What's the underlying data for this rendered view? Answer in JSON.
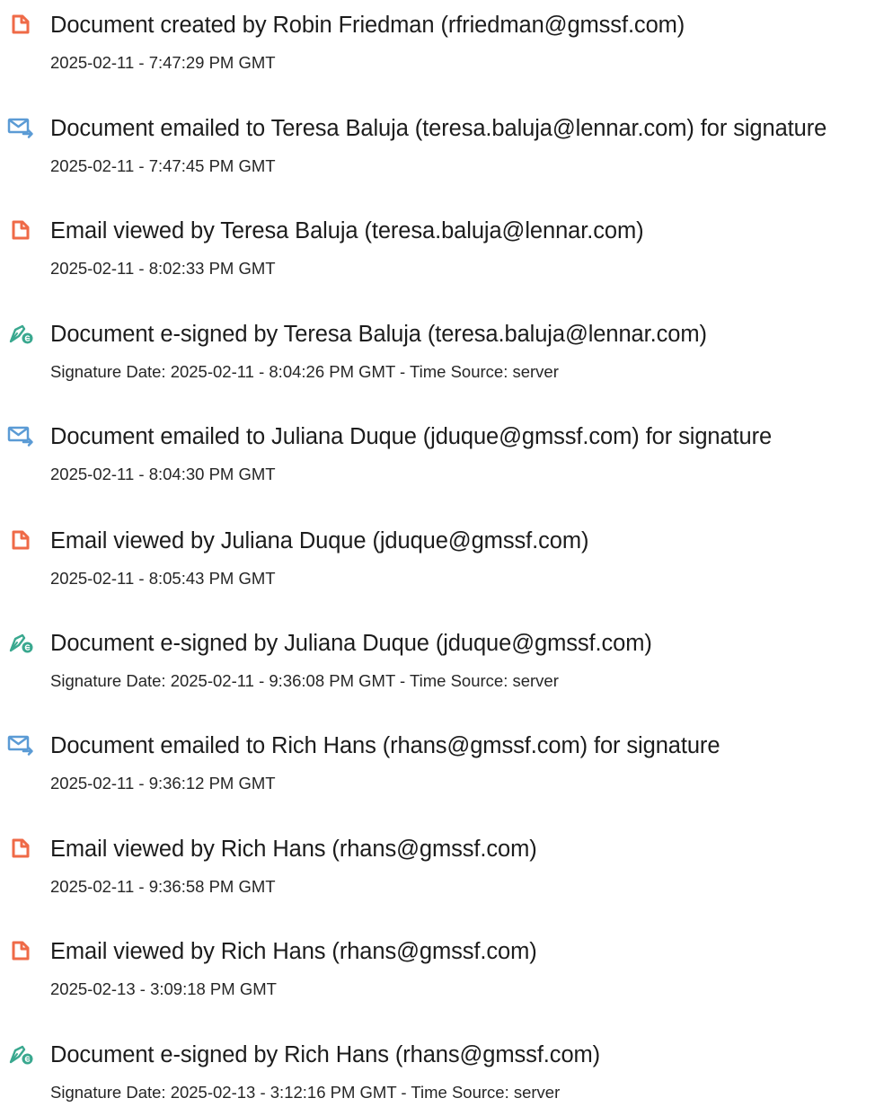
{
  "colors": {
    "doc_icon": "#ef6a47",
    "email_icon": "#5b9bd5",
    "sign_icon": "#3aa88f",
    "text": "#1c1c1c"
  },
  "entries": [
    {
      "icon": "document-icon",
      "title": "Document created by Robin Friedman (rfriedman@gmssf.com)",
      "time": "2025-02-11 - 7:47:29 PM GMT"
    },
    {
      "icon": "email-icon",
      "title": "Document emailed to Teresa Baluja (teresa.baluja@lennar.com) for signature",
      "time": "2025-02-11 - 7:47:45 PM GMT"
    },
    {
      "icon": "document-icon",
      "title": "Email viewed by Teresa Baluja (teresa.baluja@lennar.com)",
      "time": "2025-02-11 - 8:02:33 PM GMT"
    },
    {
      "icon": "e-sign-icon",
      "title": "Document e-signed by Teresa Baluja (teresa.baluja@lennar.com)",
      "time": "Signature Date: 2025-02-11 - 8:04:26 PM GMT - Time Source: server"
    },
    {
      "icon": "email-icon",
      "title": "Document emailed to Juliana Duque (jduque@gmssf.com) for signature",
      "time": "2025-02-11 - 8:04:30 PM GMT"
    },
    {
      "icon": "document-icon",
      "title": "Email viewed by Juliana Duque (jduque@gmssf.com)",
      "time": "2025-02-11 - 8:05:43 PM GMT"
    },
    {
      "icon": "e-sign-icon",
      "title": "Document e-signed by Juliana Duque (jduque@gmssf.com)",
      "time": "Signature Date: 2025-02-11 - 9:36:08 PM GMT - Time Source: server"
    },
    {
      "icon": "email-icon",
      "title": "Document emailed to Rich Hans (rhans@gmssf.com) for signature",
      "time": "2025-02-11 - 9:36:12 PM GMT"
    },
    {
      "icon": "document-icon",
      "title": "Email viewed by Rich Hans (rhans@gmssf.com)",
      "time": "2025-02-11 - 9:36:58 PM GMT"
    },
    {
      "icon": "document-icon",
      "title": "Email viewed by Rich Hans (rhans@gmssf.com)",
      "time": "2025-02-13 - 3:09:18 PM GMT"
    },
    {
      "icon": "e-sign-icon",
      "title": "Document e-signed by Rich Hans (rhans@gmssf.com)",
      "time": "Signature Date: 2025-02-13 - 3:12:16 PM GMT - Time Source: server"
    }
  ]
}
